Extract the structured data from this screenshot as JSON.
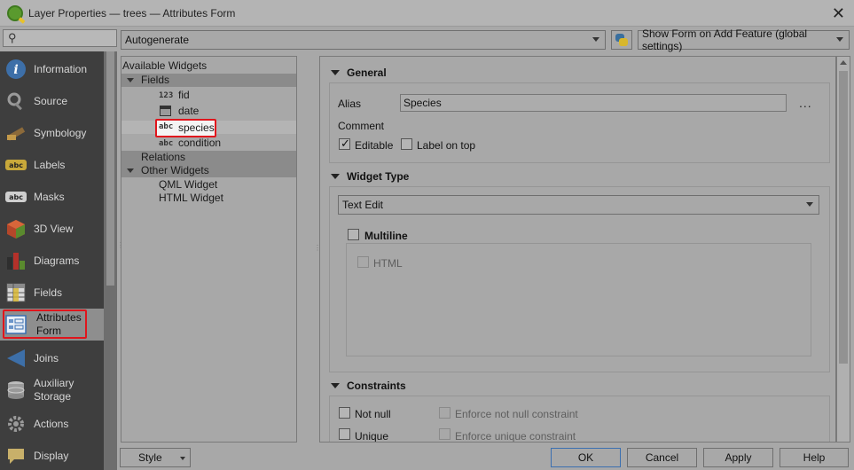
{
  "window": {
    "title": "Layer Properties — trees — Attributes Form"
  },
  "sidebar": {
    "search_icon": "search-icon",
    "items": [
      {
        "label": "Information",
        "icon": "information-icon"
      },
      {
        "label": "Source",
        "icon": "source-icon"
      },
      {
        "label": "Symbology",
        "icon": "symbology-icon"
      },
      {
        "label": "Labels",
        "icon": "labels-icon"
      },
      {
        "label": "Masks",
        "icon": "masks-icon"
      },
      {
        "label": "3D View",
        "icon": "3d-view-icon"
      },
      {
        "label": "Diagrams",
        "icon": "diagrams-icon"
      },
      {
        "label": "Fields",
        "icon": "fields-icon"
      },
      {
        "label": "Attributes Form",
        "line1": "Attributes",
        "line2": "Form",
        "icon": "attributes-form-icon",
        "active": true
      },
      {
        "label": "Joins",
        "icon": "joins-icon"
      },
      {
        "label": "Auxiliary Storage",
        "line1": "Auxiliary",
        "line2": "Storage",
        "icon": "auxiliary-storage-icon"
      },
      {
        "label": "Actions",
        "icon": "actions-icon"
      },
      {
        "label": "Display",
        "icon": "display-icon"
      }
    ]
  },
  "toolbar": {
    "layout_combo": "Autogenerate",
    "python_icon": "python-icon",
    "suppress_combo": "Show Form on Add Feature (global settings)"
  },
  "widgets_tree": {
    "header": "Available Widgets",
    "fields_group": "Fields",
    "fields": [
      {
        "type_badge": "123",
        "name": "fid"
      },
      {
        "type_badge": "calendar",
        "name": "date"
      },
      {
        "type_badge": "abc",
        "name": "species"
      },
      {
        "type_badge": "abc",
        "name": "condition"
      }
    ],
    "relations_group": "Relations",
    "other_group": "Other Widgets",
    "other": [
      "QML Widget",
      "HTML Widget"
    ]
  },
  "general": {
    "title": "General",
    "alias_label": "Alias",
    "alias_value": "Species",
    "dots": "...",
    "comment_label": "Comment",
    "editable_label": "Editable",
    "editable_checked": true,
    "label_on_top_label": "Label on top",
    "label_on_top_checked": false
  },
  "widget_type": {
    "title": "Widget Type",
    "selected": "Text Edit",
    "multiline_label": "Multiline",
    "multiline_checked": false,
    "html_label": "HTML",
    "html_checked": false
  },
  "constraints": {
    "title": "Constraints",
    "not_null_label": "Not null",
    "enforce_not_null_label": "Enforce not null constraint",
    "unique_label": "Unique",
    "enforce_unique_label": "Enforce unique constraint"
  },
  "buttons": {
    "style": "Style",
    "ok": "OK",
    "cancel": "Cancel",
    "apply": "Apply",
    "help": "Help"
  },
  "colors": {
    "highlight_red": "#e0151c",
    "sidebar_bg": "#3e3e3e",
    "overlay_gray": "#a8a8a8"
  }
}
